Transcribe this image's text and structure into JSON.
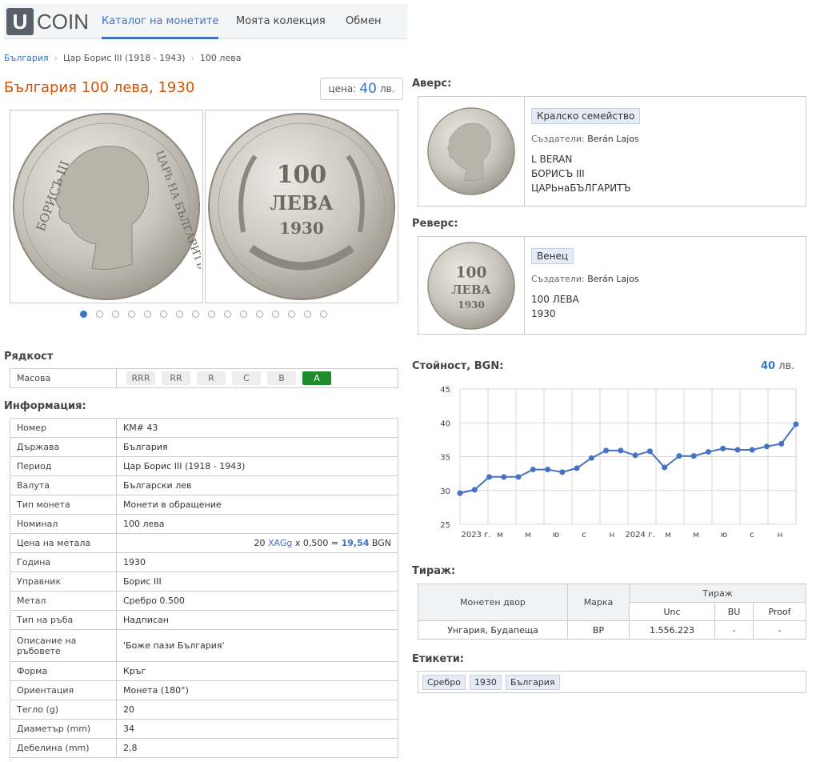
{
  "header": {
    "logo_letter": "U",
    "logo_text": "COIN",
    "tabs": [
      "Каталог на монетите",
      "Моята колекция",
      "Обмен"
    ]
  },
  "breadcrumb": [
    "България",
    "Цар Борис III (1918 - 1943)",
    "100 лева"
  ],
  "title": "България 100 лева, 1930",
  "price": {
    "label": "цена:",
    "value": "40",
    "unit": "лв."
  },
  "images": {
    "obverse_alt": "БОРИСЪ III ЦАРЬ НА БЪЛГАРИТЪ",
    "reverse_text": [
      "100",
      "ЛЕВА",
      "1930"
    ]
  },
  "gallery_dots": {
    "count": 16,
    "active": 0
  },
  "rarity": {
    "heading": "Рядкост",
    "label": "Масова",
    "levels": [
      "RRR",
      "RR",
      "R",
      "C",
      "B",
      "A"
    ],
    "active": "A"
  },
  "info": {
    "heading": "Информация:",
    "rows": [
      [
        "Номер",
        "KM# 43"
      ],
      [
        "Държава",
        "България"
      ],
      [
        "Период",
        "Цар Борис III (1918 - 1943)"
      ],
      [
        "Валута",
        "Български лев"
      ],
      [
        "Тип монета",
        "Монети в обращение"
      ],
      [
        "Номинал",
        "100 лева"
      ],
      [
        "Цена на метала",
        ""
      ],
      [
        "Година",
        "1930"
      ],
      [
        "Управник",
        "Борис III"
      ],
      [
        "Метал",
        "Сребро 0.500"
      ],
      [
        "Тип на ръба",
        "Надписан"
      ],
      [
        "Описание на ръбовете",
        "'Боже пази България'"
      ],
      [
        "Форма",
        "Кръг"
      ],
      [
        "Ориентация",
        "Монета (180°)"
      ],
      [
        "Тегло (g)",
        "20"
      ],
      [
        "Диаметър (mm)",
        "34"
      ],
      [
        "Дебелина (mm)",
        "2,8"
      ]
    ],
    "metal_price": {
      "amount": "20",
      "unit": "XAGg",
      "mult": "x 0,500 =",
      "result": "19,54",
      "currency": "BGN"
    }
  },
  "obverse": {
    "heading": "Аверс:",
    "tag": "Кралско семейство",
    "creators_label": "Създатели:",
    "creators": "Berán Lajos",
    "lines": [
      "L BERAN",
      "БОРИСЪ III",
      "ЦАРЬнаБЪЛГАРИТЪ"
    ]
  },
  "reverse": {
    "heading": "Реверс:",
    "tag": "Венец",
    "creators_label": "Създатели:",
    "creators": "Berán Lajos",
    "lines": [
      "100 ЛЕВА",
      "1930"
    ]
  },
  "value": {
    "heading": "Стойност, BGN:",
    "amount": "40",
    "unit": "лв."
  },
  "chart_data": {
    "type": "line",
    "ylim": [
      25,
      45
    ],
    "yticks": [
      25,
      30,
      35,
      40,
      45
    ],
    "xticks": [
      "2023 г.",
      "м",
      "м",
      "ю",
      "с",
      "н",
      "2024 г.",
      "м",
      "м",
      "ю",
      "с",
      "н"
    ],
    "color": "#4472c4",
    "series": [
      {
        "values": [
          29.6,
          30.1,
          32.0,
          32.0,
          32.0,
          33.1,
          33.1,
          32.7,
          33.3,
          34.8,
          35.9,
          35.9,
          35.2,
          35.8,
          33.4,
          35.1,
          35.1,
          35.7,
          36.2,
          36.0,
          36.0,
          36.5,
          36.9,
          39.8
        ]
      }
    ]
  },
  "mintage": {
    "heading": "Тираж:",
    "col_mint": "Монетен двор",
    "col_mark": "Марка",
    "col_group": "Тираж",
    "sub_cols": [
      "Unc",
      "BU",
      "Proof"
    ],
    "rows": [
      [
        "Унгария, Будапеща",
        "BP",
        "1.556.223",
        "-",
        "-"
      ]
    ]
  },
  "labels": {
    "heading": "Етикети:",
    "items": [
      "Сребро",
      "1930",
      "България"
    ]
  }
}
